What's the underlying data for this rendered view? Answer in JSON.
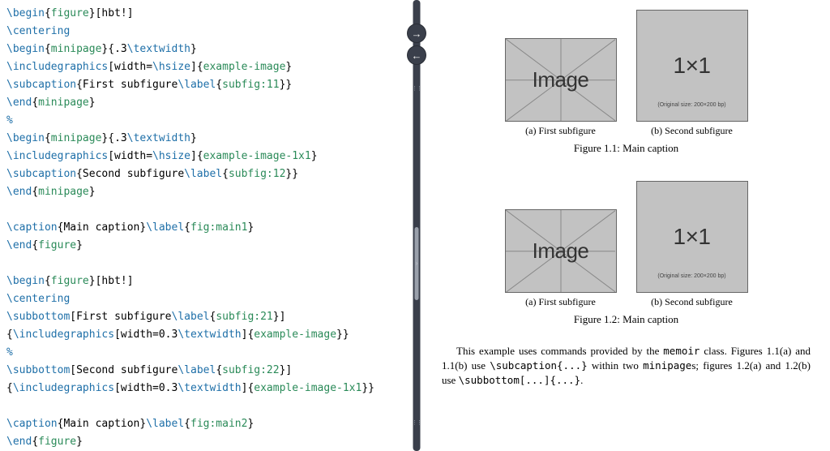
{
  "code": {
    "l1": {
      "cmd": "\\begin",
      "arg": "figure",
      "opt": "[hbt!]"
    },
    "l2": {
      "cmd": "\\centering"
    },
    "l3": {
      "cmd": "\\begin",
      "arg": "minipage",
      "txt": "{.3",
      "cmd2": "\\textwidth",
      "txt2": "}"
    },
    "l4": {
      "cmd": "\\includegraphics",
      "txt": "[width=",
      "cmd2": "\\hsize",
      "txt2": "]{",
      "arg": "example-image",
      "txt3": "}"
    },
    "l5": {
      "cmd": "\\subcaption",
      "txt": "{First subfigure",
      "cmd2": "\\label",
      "txt2": "{",
      "arg": "subfig:11",
      "txt3": "}}"
    },
    "l6": {
      "cmd": "\\end",
      "arg": "minipage"
    },
    "l7": {
      "comment": "%"
    },
    "l8": {
      "cmd": "\\begin",
      "arg": "minipage",
      "txt": "{.3",
      "cmd2": "\\textwidth",
      "txt2": "}"
    },
    "l9": {
      "cmd": "\\includegraphics",
      "txt": "[width=",
      "cmd2": "\\hsize",
      "txt2": "]{",
      "arg": "example-image-1x1",
      "txt3": "}"
    },
    "l10": {
      "cmd": "\\subcaption",
      "txt": "{Second subfigure",
      "cmd2": "\\label",
      "txt2": "{",
      "arg": "subfig:12",
      "txt3": "}}"
    },
    "l11": {
      "cmd": "\\end",
      "arg": "minipage"
    },
    "l12": {
      "blank": " "
    },
    "l13": {
      "cmd": "\\caption",
      "txt": "{Main caption}",
      "cmd2": "\\label",
      "txt2": "{",
      "arg": "fig:main1",
      "txt3": "}"
    },
    "l14": {
      "cmd": "\\end",
      "arg": "figure"
    },
    "l15": {
      "blank": " "
    },
    "l16": {
      "cmd": "\\begin",
      "arg": "figure",
      "opt": "[hbt!]"
    },
    "l17": {
      "cmd": "\\centering"
    },
    "l18": {
      "cmd": "\\subbottom",
      "txt": "[First subfigure",
      "cmd2": "\\label",
      "txt2": "{",
      "arg": "subfig:21",
      "txt3": "}]"
    },
    "l19": {
      "txt": "{",
      "cmd": "\\includegraphics",
      "txt2": "[width=0.3",
      "cmd2": "\\textwidth",
      "txt3": "]{",
      "arg": "example-image",
      "txt4": "}}"
    },
    "l20": {
      "comment": "%"
    },
    "l21": {
      "cmd": "\\subbottom",
      "txt": "[Second subfigure",
      "cmd2": "\\label",
      "txt2": "{",
      "arg": "subfig:22",
      "txt3": "}]"
    },
    "l22": {
      "txt": "{",
      "cmd": "\\includegraphics",
      "txt2": "[width=0.3",
      "cmd2": "\\textwidth",
      "txt3": "]{",
      "arg": "example-image-1x1",
      "txt4": "}}"
    },
    "l23": {
      "blank": " "
    },
    "l24": {
      "cmd": "\\caption",
      "txt": "{Main caption}",
      "cmd2": "\\label",
      "txt2": "{",
      "arg": "fig:main2",
      "txt3": "}"
    },
    "l25": {
      "cmd": "\\end",
      "arg": "figure"
    }
  },
  "preview": {
    "img_label": "Image",
    "one_by_one": "1×1",
    "orig_note": "(Original size: 200×200 bp)",
    "sub_a": "(a) First subfigure",
    "sub_b": "(b) Second subfigure",
    "cap1": "Figure 1.1: Main caption",
    "cap2": "Figure 1.2: Main caption",
    "body_1a": "This example uses commands provided by the ",
    "body_1b": "memoir",
    "body_1c": " class. Figures 1.1(a) and 1.1(b) use ",
    "body_1d": "\\subcaption{...}",
    "body_1e": " within two ",
    "body_1f": "minipage",
    "body_1g": "s; figures 1.2(a) and 1.2(b) use ",
    "body_1h": "\\subbottom[...]{...}",
    "body_1i": "."
  },
  "icons": {
    "fwd": "→",
    "back": "←",
    "mid": "›"
  }
}
